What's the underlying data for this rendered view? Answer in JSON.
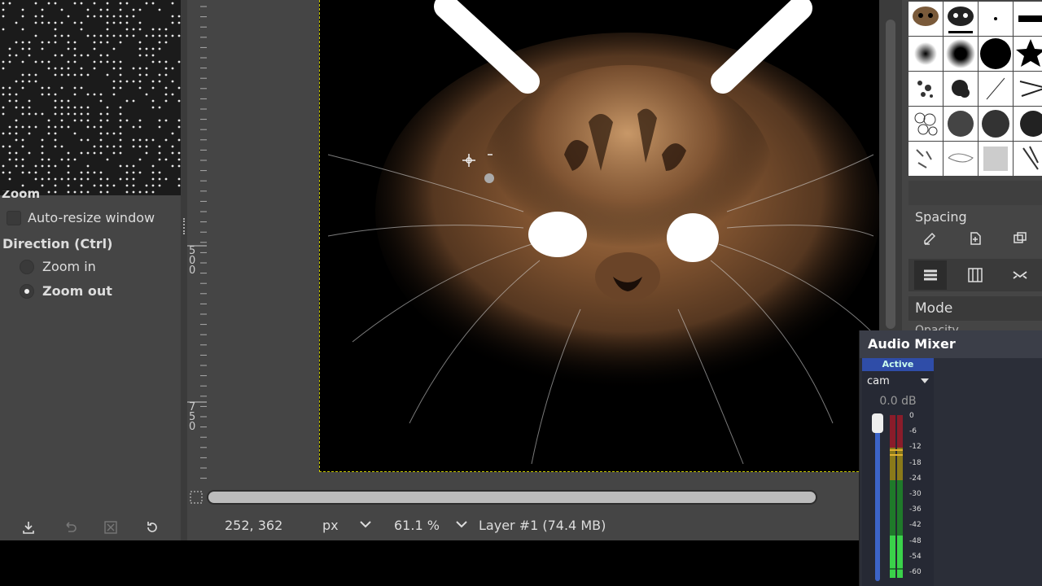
{
  "tool_options": {
    "section_title": "Zoom",
    "auto_resize_label": "Auto-resize window",
    "auto_resize_checked": false,
    "direction_title": "Direction  (Ctrl)",
    "zoom_in_label": "Zoom in",
    "zoom_out_label": "Zoom out",
    "selected_direction": "zoom-out"
  },
  "left_toolbar": {
    "icons": [
      "save-to-preset-icon",
      "restore-icon",
      "delete-icon",
      "reset-icon"
    ]
  },
  "ruler": {
    "marks": [
      "5\n0\n0",
      "7\n5\n0"
    ]
  },
  "status": {
    "coords": "252, 362",
    "unit": "px",
    "zoom": "61.1 %",
    "layer": "Layer #1 (74.4 MB)"
  },
  "brushes_panel": {
    "spacing_label": "Spacing",
    "mode_label": "Mode",
    "opacity_label": "Opacity"
  },
  "audio_mixer": {
    "title": "Audio Mixer",
    "status_badge": "Active",
    "source_name": "cam",
    "volume": "0.0 dB",
    "fader_level": 1.0,
    "scale": [
      "0",
      "-6",
      "-12",
      "-18",
      "-24",
      "-30",
      "-36",
      "-42",
      "-48",
      "-54",
      "-60"
    ]
  },
  "colors": {
    "selection_outline": "#c8c800",
    "active_badge": "#2f4da8",
    "fader": "#3c64c8"
  }
}
